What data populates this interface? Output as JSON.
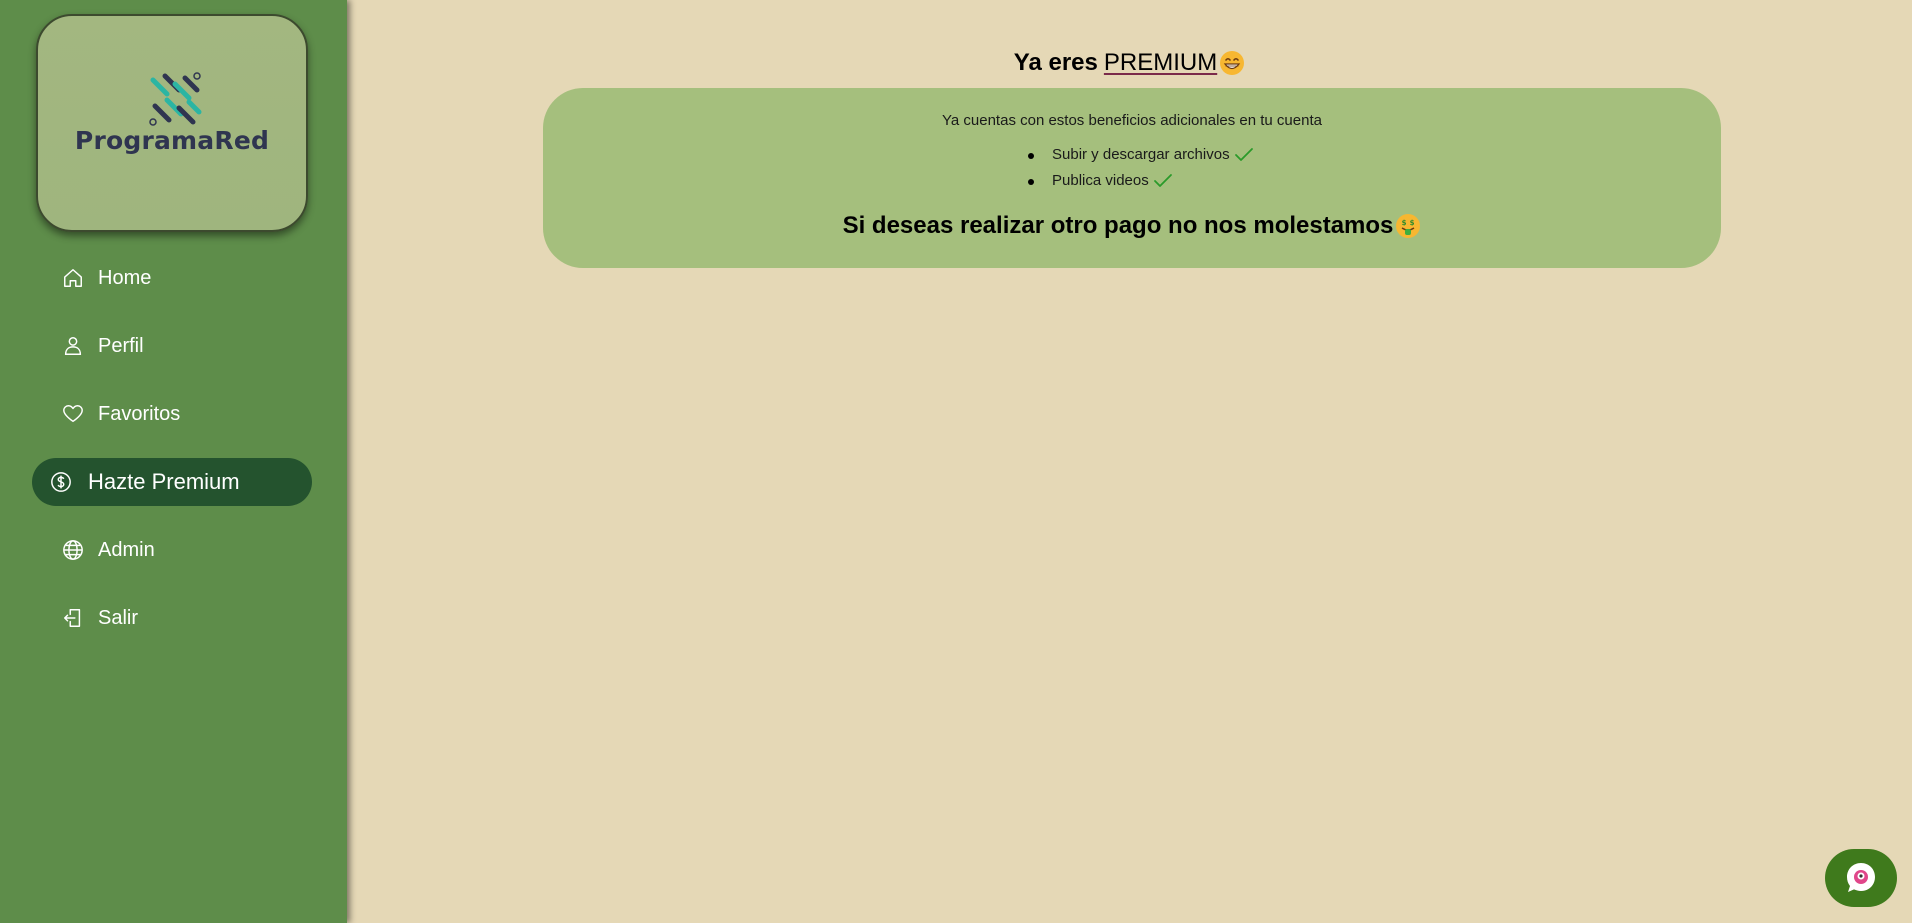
{
  "brand": {
    "name": "ProgramaRed"
  },
  "sidebar": {
    "items": [
      {
        "label": "Home",
        "icon": "home-icon"
      },
      {
        "label": "Perfil",
        "icon": "user-icon"
      },
      {
        "label": "Favoritos",
        "icon": "heart-icon"
      },
      {
        "label": "Hazte Premium",
        "icon": "dollar-circle-icon",
        "active": true
      },
      {
        "label": "Admin",
        "icon": "globe-icon"
      },
      {
        "label": "Salir",
        "icon": "logout-icon"
      }
    ]
  },
  "main": {
    "title_prefix": "Ya eres",
    "title_highlight": "PREMIUM",
    "title_emoji": "grinning-face-emoji",
    "card": {
      "intro": "Ya cuentas con estos beneficios adicionales en tu cuenta",
      "benefits": [
        {
          "label": "Subir y descargar archivos",
          "icon": "check-icon"
        },
        {
          "label": "Publica videos",
          "icon": "check-icon"
        }
      ],
      "footer": "Si deseas realizar otro pago no nos molestamos",
      "footer_emoji": "money-mouth-face-emoji"
    }
  },
  "chat": {
    "icon": "chat-bubble-icon"
  },
  "colors": {
    "background": "#e5d8b6",
    "sidebar": "#5e8d4a",
    "active_item": "#24532e",
    "card": "#a5bf7d",
    "check": "#2a9a2a",
    "chat_button": "#3f7a1c"
  }
}
